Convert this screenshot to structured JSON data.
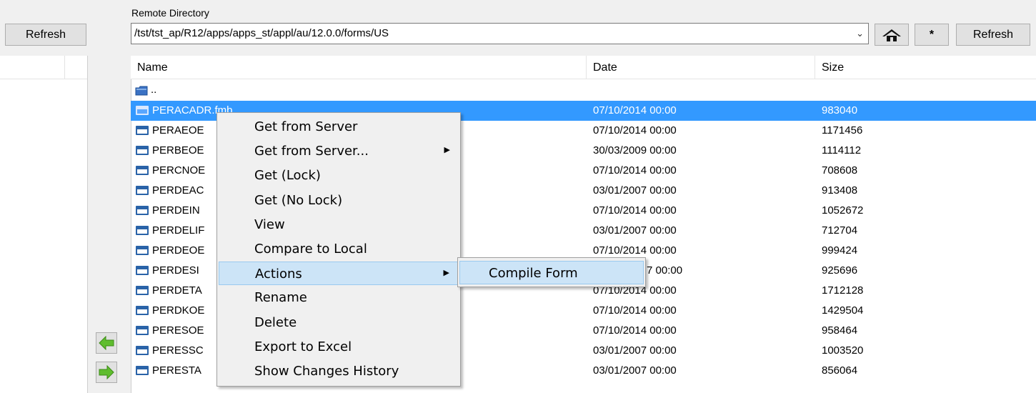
{
  "left": {
    "refresh_label": "Refresh"
  },
  "remote": {
    "section_label": "Remote Directory",
    "path": "/tst/tst_ap/R12/apps/apps_st/appl/au/12.0.0/forms/US",
    "star_label": "*",
    "refresh_label": "Refresh"
  },
  "list": {
    "columns": [
      "Name",
      "Date",
      "Size"
    ],
    "parent_label": "..",
    "rows": [
      {
        "name": "PERACADR.fmb",
        "date": "07/10/2014 00:00",
        "size": "983040"
      },
      {
        "name": "PERAEOE",
        "date": "07/10/2014 00:00",
        "size": "1171456"
      },
      {
        "name": "PERBEOE",
        "date": "30/03/2009 00:00",
        "size": "1114112"
      },
      {
        "name": "PERCNOE",
        "date": "07/10/2014 00:00",
        "size": "708608"
      },
      {
        "name": "PERDEAC",
        "date": "03/01/2007 00:00",
        "size": "913408"
      },
      {
        "name": "PERDEIN",
        "date": "07/10/2014 00:00",
        "size": "1052672"
      },
      {
        "name": "PERDELIF",
        "date": "03/01/2007 00:00",
        "size": "712704"
      },
      {
        "name": "PERDEOE",
        "date": "07/10/2014 00:00",
        "size": "999424"
      },
      {
        "name": "PERDESI",
        "date": "7 00:00",
        "size": "925696"
      },
      {
        "name": "PERDETA",
        "date": "07/10/2014 00:00",
        "size": "1712128"
      },
      {
        "name": "PERDKOE",
        "date": "07/10/2014 00:00",
        "size": "1429504"
      },
      {
        "name": "PERESOE",
        "date": "07/10/2014 00:00",
        "size": "958464"
      },
      {
        "name": "PERESSC",
        "date": "03/01/2007 00:00",
        "size": "1003520"
      },
      {
        "name": "PERESTA",
        "date": "03/01/2007 00:00",
        "size": "856064"
      }
    ],
    "selected_index": 0
  },
  "context_menu": {
    "items": [
      {
        "label": "Get from Server",
        "submenu": false
      },
      {
        "label": "Get from Server...",
        "submenu": true
      },
      {
        "label": "Get (Lock)",
        "submenu": false
      },
      {
        "label": "Get (No Lock)",
        "submenu": false
      },
      {
        "label": "View",
        "submenu": false
      },
      {
        "label": "Compare to Local",
        "submenu": false
      },
      {
        "label": "Actions",
        "submenu": true
      },
      {
        "label": "Rename",
        "submenu": false
      },
      {
        "label": "Delete",
        "submenu": false
      },
      {
        "label": "Export to Excel",
        "submenu": false
      },
      {
        "label": "Show Changes History",
        "submenu": false
      }
    ],
    "highlighted_index": 6,
    "submenu_items": [
      {
        "label": "Compile Form"
      }
    ]
  },
  "icons": {
    "home": "home-icon",
    "dropdown": "chevron-down-icon",
    "folder_up": "folder-up-icon",
    "file": "form-file-icon",
    "upload": "green-arrow-left-icon",
    "download": "green-arrow-right-icon",
    "submenu": "chevron-right-icon"
  },
  "colors": {
    "selection": "#3399ff",
    "menu_highlight": "#cce4f7",
    "arrow_green": "#5fbd2e"
  }
}
